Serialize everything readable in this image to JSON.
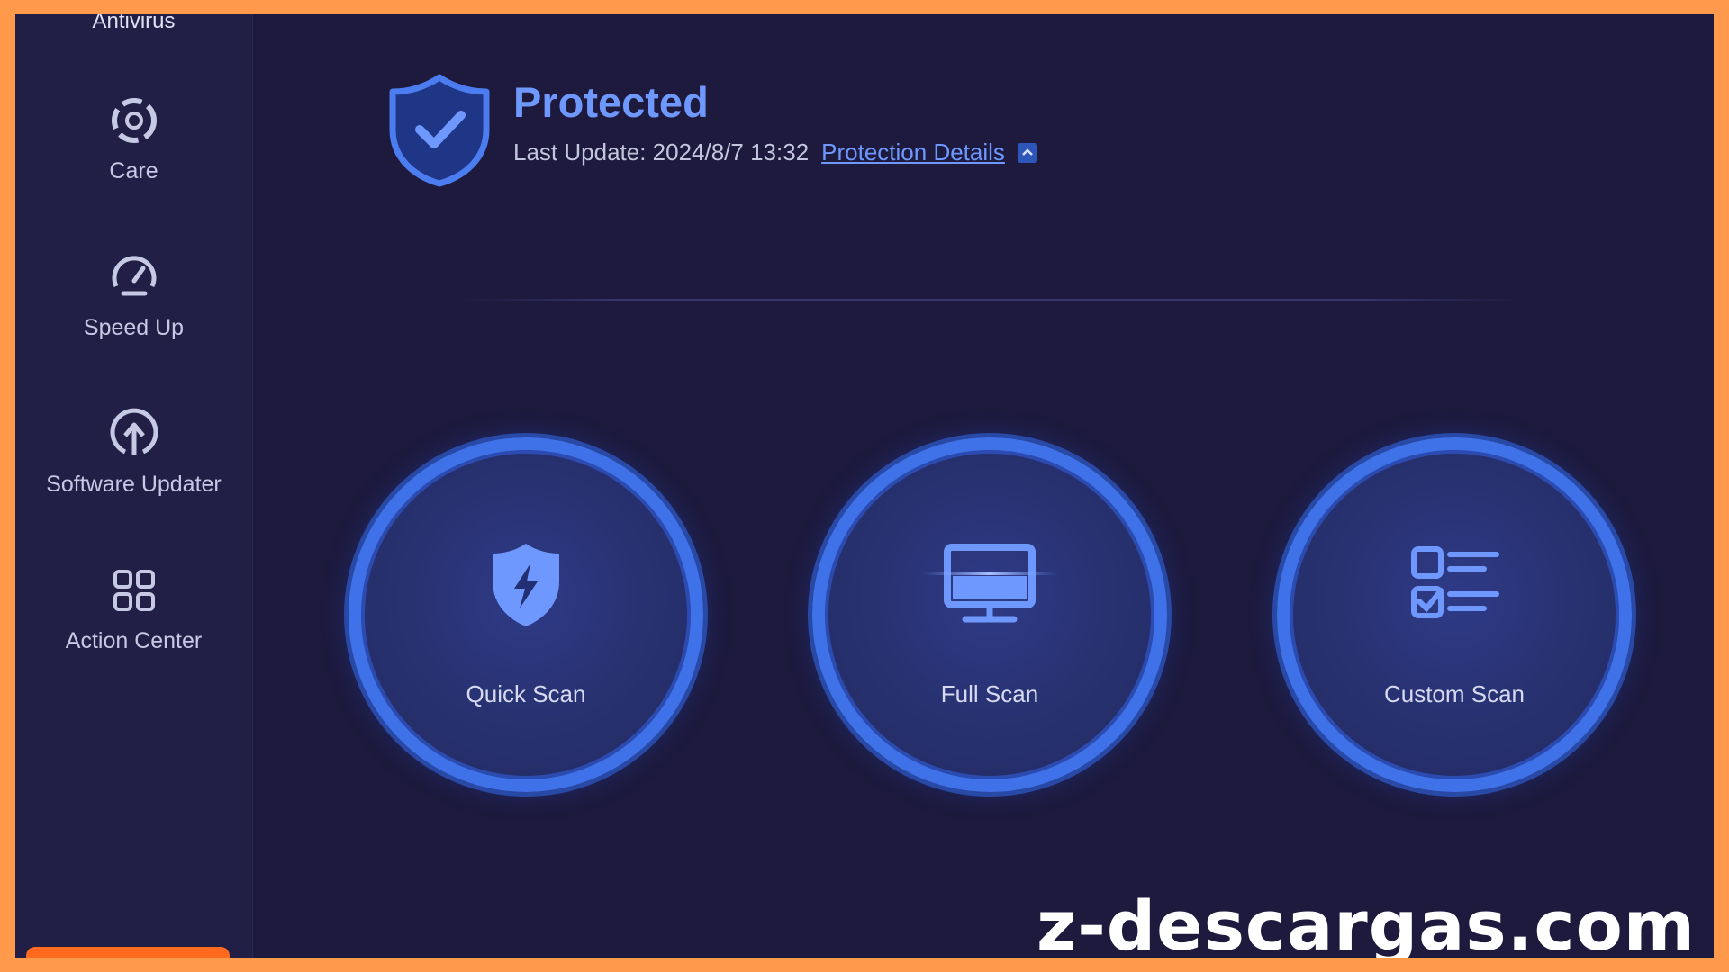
{
  "sidebar": {
    "top_label": "Antivirus",
    "items": [
      {
        "label": "Care",
        "icon": "care-icon"
      },
      {
        "label": "Speed Up",
        "icon": "speedometer-icon"
      },
      {
        "label": "Software Updater",
        "icon": "upload-arrow-icon"
      },
      {
        "label": "Action Center",
        "icon": "grid-icon"
      }
    ]
  },
  "status": {
    "title": "Protected",
    "last_update_label": "Last Update: 2024/8/7 13:32",
    "details_link": "Protection Details",
    "icon": "shield-check-icon"
  },
  "scans": [
    {
      "label": "Quick Scan",
      "icon": "shield-bolt-icon"
    },
    {
      "label": "Full Scan",
      "icon": "monitor-icon"
    },
    {
      "label": "Custom Scan",
      "icon": "checklist-icon"
    }
  ],
  "watermark": "z-descargas.com",
  "colors": {
    "frame": "#ff9a4d",
    "background": "#1d1a3d",
    "sidebar": "#211f45",
    "accent": "#6f98ff",
    "ring": "#3f72e8"
  }
}
